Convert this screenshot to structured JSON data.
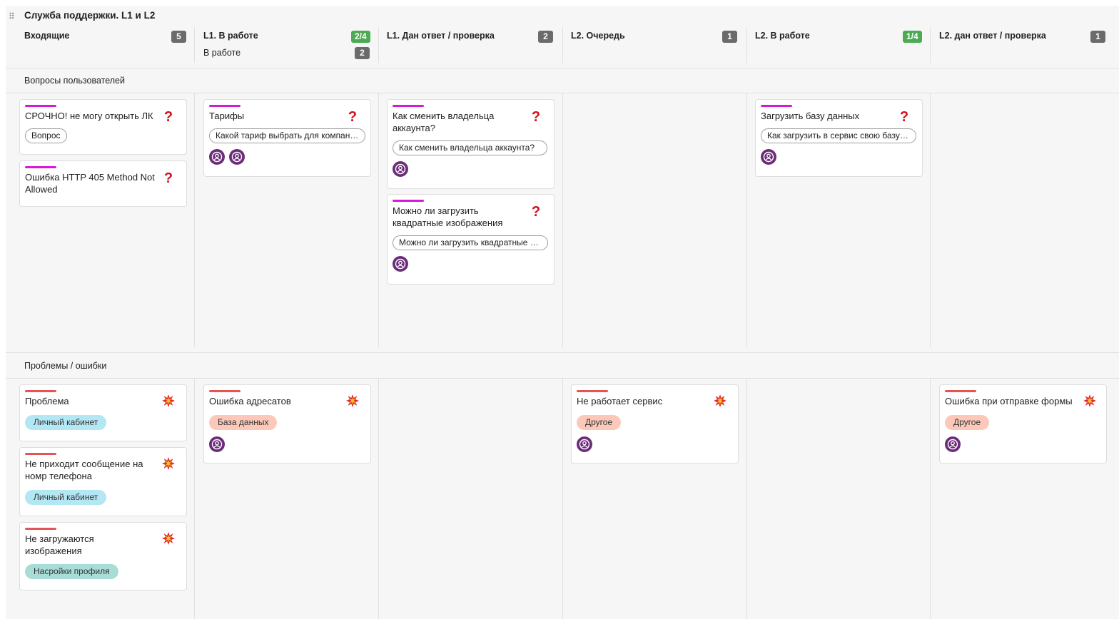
{
  "board": {
    "title": "Служба поддержки. L1 и L2",
    "drag_icon": "drag-handle-icon"
  },
  "columns": [
    {
      "name": "Входящие",
      "count": "5"
    },
    {
      "name": "L1. В работе",
      "count": "2/4",
      "sub_name": "В работе",
      "sub_count": "2"
    },
    {
      "name": "L1. Дан ответ / проверка",
      "count": "2"
    },
    {
      "name": "L2. Очередь",
      "count": "1"
    },
    {
      "name": "L2. В работе",
      "count": "1/4"
    },
    {
      "name": "L2. дан ответ / проверка",
      "count": "1"
    }
  ],
  "lanes": [
    {
      "title": "Вопросы пользователей"
    },
    {
      "title": "Проблемы / ошибки"
    }
  ],
  "cards": {
    "q1": {
      "title": "СРОЧНО! не могу открыть ЛК",
      "tag": "Вопрос"
    },
    "q2": {
      "title": "Ошибка HTTP 405 Method Not Allowed"
    },
    "q3": {
      "title": "Тарифы",
      "tag": "Какой тариф выбрать для компании"
    },
    "q4": {
      "title": "Как сменить владельца аккаунта?",
      "tag": "Как сменить владельца аккаунта?"
    },
    "q5": {
      "title": "Можно ли загрузить квадратные изображения",
      "tag": "Можно ли загрузить квадратные изображения"
    },
    "q6": {
      "title": "Загрузить базу данных",
      "tag": "Как загрузить в сервис свою базу данных"
    },
    "p1": {
      "title": "Проблема",
      "tag": "Личный кабинет"
    },
    "p2": {
      "title": "Не приходит сообщение на номр телефона",
      "tag": "Личный кабинет"
    },
    "p3": {
      "title": "Не загружаются изображения",
      "tag": "Насройки профиля"
    },
    "p4": {
      "title": "Ошибка адресатов",
      "tag": "База данных"
    },
    "p5": {
      "title": "Не работает сервис",
      "tag": "Другое"
    },
    "p6": {
      "title": "Ошибка при отправке формы",
      "tag": "Другое"
    }
  },
  "icons": {
    "question": "?",
    "problem": "explosion-icon",
    "user": "user-avatar-icon"
  },
  "colors": {
    "question_stripe": "#d31ad6",
    "problem_stripe": "#e35454",
    "count_badge": "#6b6b6b",
    "limit_badge": "#4cab52",
    "avatar": "#6b2d79"
  }
}
